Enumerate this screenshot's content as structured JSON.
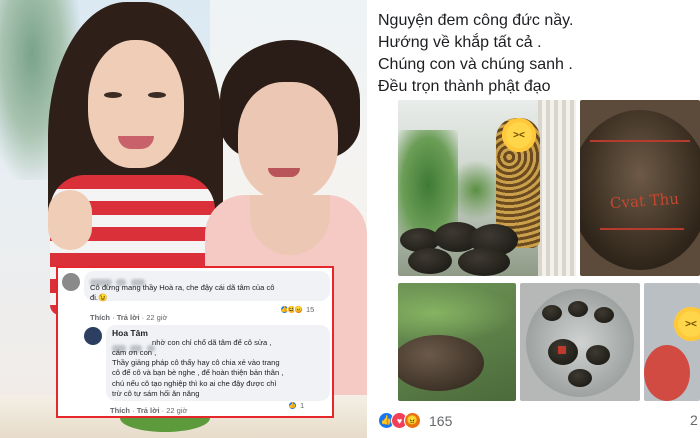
{
  "left_photo": {
    "comment_box": {
      "border_color": "#e5262b",
      "comment1": {
        "author_blurred": true,
        "text_line1": "Cô đừng mang thầy Hoà ra, che đậy cái dã tâm của cô",
        "text_line2": "đi.😉",
        "like_label": "Thích",
        "reply_label": "Trả lời",
        "time": "22 giờ",
        "reaction_count": "15",
        "reaction_icons": [
          "like-icon",
          "haha-icon",
          "angry-icon"
        ]
      },
      "comment2": {
        "author": "Hoa Tâm",
        "text_line1": "nhờ con chỉ chổ dã tâm để cô sửa ,",
        "text_line2": "cám ơn con ,",
        "text_line3": "Thầy giảng pháp cô thấy hay cô chia xẻ vào trang",
        "text_line4": "cô để cô và bạn bè nghe , để hoàn thiện bản thân ,",
        "text_line5": "chú nếu cô tạo nghiệp thì ko ai che đậy được chỉ",
        "text_line6": "trừ cô tự sám hối ăn năng",
        "like_label": "Thích",
        "reply_label": "Trả lời",
        "time": "22 giờ",
        "reaction_count": "1",
        "reaction_icons": [
          "like-icon"
        ]
      }
    }
  },
  "post": {
    "lines": [
      "Nguyện đem công đức nầy.",
      "Hướng về khắp tất cả .",
      "Chúng con và chúng sanh .",
      "Đều trọn thành phật đạo"
    ],
    "photo_text_red": "Cvat Thu",
    "reactions": {
      "icons": [
        "like-icon",
        "love-icon",
        "angry-icon"
      ],
      "count": "165"
    },
    "comments_partial": "2"
  },
  "colors": {
    "facebook_blue": "#1877f2",
    "love_red": "#f33e58",
    "angry_orange": "#e9710f"
  }
}
